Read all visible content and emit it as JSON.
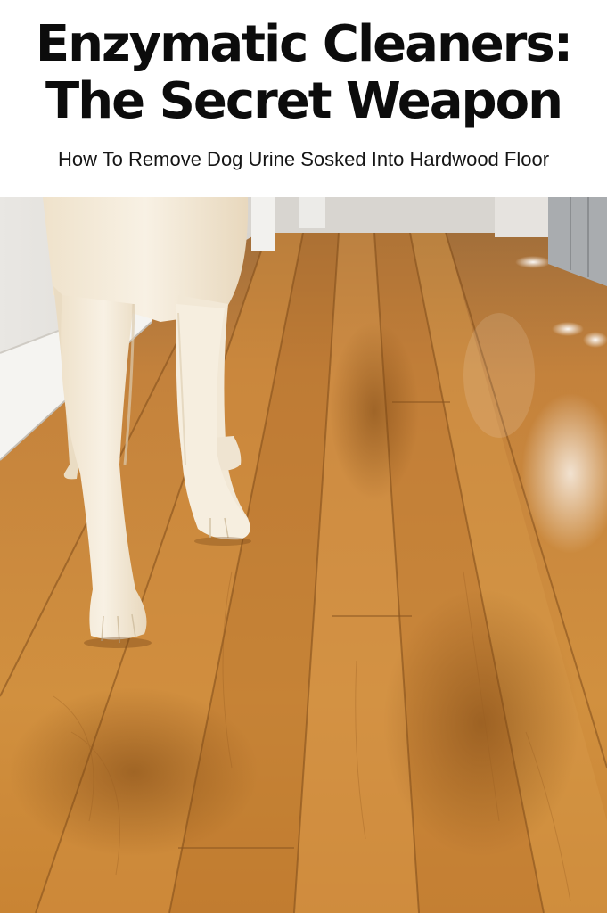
{
  "pin": {
    "title_line_1": "Enzymatic Cleaners:",
    "title_line_2": "The Secret Weapon",
    "subtitle": "How To Remove Dog Urine Sosked Into Hardwood Floor"
  },
  "photo": {
    "subject": "dog-on-hardwood-floor",
    "colors": {
      "wood_light": "#d58f45",
      "wood_mid": "#c07a2e",
      "wood_dark": "#8e5418",
      "wall": "#eceae6",
      "fur": "#f4ebd9"
    }
  }
}
